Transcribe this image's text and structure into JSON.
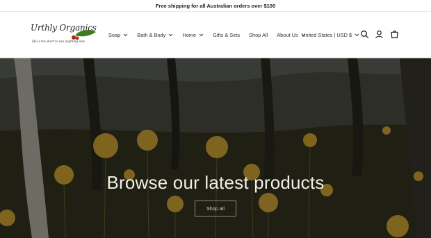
{
  "announcement": {
    "text": "Free shipping for all Australian orders over $100"
  },
  "brand": {
    "name": "Urthly Organics",
    "tagline": "life is too short to use anything else"
  },
  "nav": {
    "items": [
      {
        "label": "Soap",
        "has_dropdown": true
      },
      {
        "label": "Bath & Body",
        "has_dropdown": true
      },
      {
        "label": "Home",
        "has_dropdown": true
      },
      {
        "label": "Gifts & Sets",
        "has_dropdown": false
      },
      {
        "label": "Shop All",
        "has_dropdown": false
      },
      {
        "label": "About Us",
        "has_dropdown": true
      }
    ]
  },
  "locale": {
    "label": "United States | USD $"
  },
  "header_icons": [
    "search-icon",
    "account-icon",
    "cart-icon"
  ],
  "hero": {
    "title": "Browse our latest products",
    "button_label": "Shop all"
  },
  "colors": {
    "text": "#121212",
    "hero_overlay": "#2f2b1f",
    "flower": "#b8912a"
  }
}
